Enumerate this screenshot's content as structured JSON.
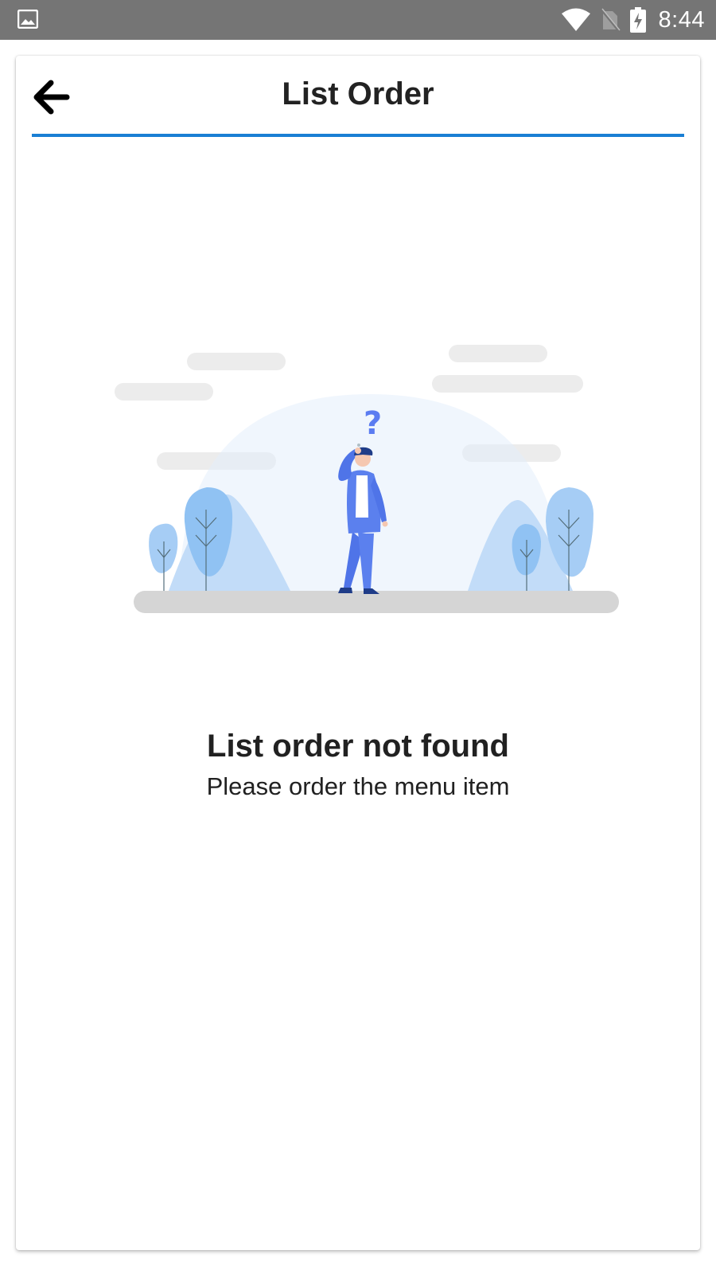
{
  "status_bar": {
    "time": "8:44",
    "icons": [
      "image-icon",
      "wifi-icon",
      "no-sim-icon",
      "battery-charging-icon"
    ]
  },
  "toolbar": {
    "title": "List Order",
    "back_icon": "arrow-left-icon",
    "accent_color": "#1a7fd4"
  },
  "empty_state": {
    "illustration": "confused-person-illustration",
    "title": "List order not found",
    "subtitle": "Please order the menu item"
  }
}
